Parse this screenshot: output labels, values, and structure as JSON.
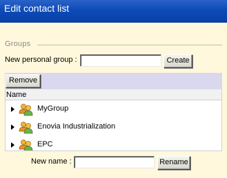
{
  "window": {
    "title": "Edit contact list"
  },
  "groups": {
    "legend": "Groups",
    "new_group_label": "New personal group :",
    "new_group_value": "",
    "create_label": "Create",
    "remove_label": "Remove",
    "column_name": "Name",
    "items": [
      {
        "label": "MyGroup",
        "icon": "group-icon"
      },
      {
        "label": "Enovia Industrialization",
        "icon": "group-icon"
      },
      {
        "label": "EPC",
        "icon": "group-icon"
      }
    ],
    "new_name_label": "New name :",
    "new_name_value": "",
    "rename_label": "Rename"
  },
  "colors": {
    "title_bar": "#0c4bb8",
    "background": "#fff8dc",
    "toolbar": "#d9d8ee"
  }
}
